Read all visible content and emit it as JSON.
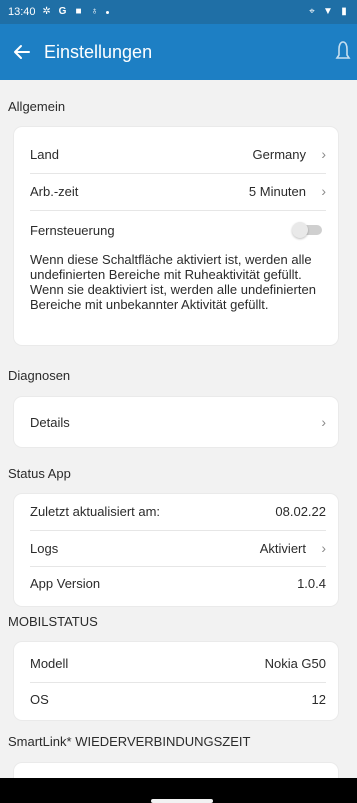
{
  "status_bar": {
    "time": "13:40",
    "left_icons": [
      "gear-icon",
      "g-icon",
      "square-icon",
      "person-icon",
      "dot-icon"
    ],
    "right_icons": [
      "location-icon",
      "wifi-icon",
      "battery-icon"
    ]
  },
  "app_bar": {
    "title": "Einstellungen",
    "back_icon": "back-arrow-icon",
    "right_icon": "bell-icon",
    "color": "#1d7fc4"
  },
  "sections": {
    "general": {
      "title": "Allgemein",
      "land_label": "Land",
      "land_value": "Germany",
      "arb_label": "Arb.-zeit",
      "arb_value": "5 Minuten",
      "remote_label": "Fernsteuerung",
      "remote_enabled": false,
      "description": "Wenn diese Schaltfläche aktiviert ist, werden alle undefinierten Bereiche mit Ruheaktivität gefüllt. Wenn sie deaktiviert ist, werden alle undefinierten Bereiche mit unbekannter Aktivität gefüllt."
    },
    "diagnostics": {
      "title": "Diagnosen",
      "details_label": "Details"
    },
    "status_app": {
      "title": "Status App",
      "updated_label": "Zuletzt aktualisiert am:",
      "updated_value": "08.02.22",
      "logs_label": "Logs",
      "logs_value": "Aktiviert",
      "version_label": "App Version",
      "version_value": "1.0.4"
    },
    "mobile": {
      "title": "MOBILSTATUS",
      "model_label": "Modell",
      "model_value": "Nokia G50",
      "os_label": "OS",
      "os_value": "12"
    },
    "smartlink": {
      "title": "SmartLink* WIEDERVERBINDUNGSZEIT"
    }
  }
}
